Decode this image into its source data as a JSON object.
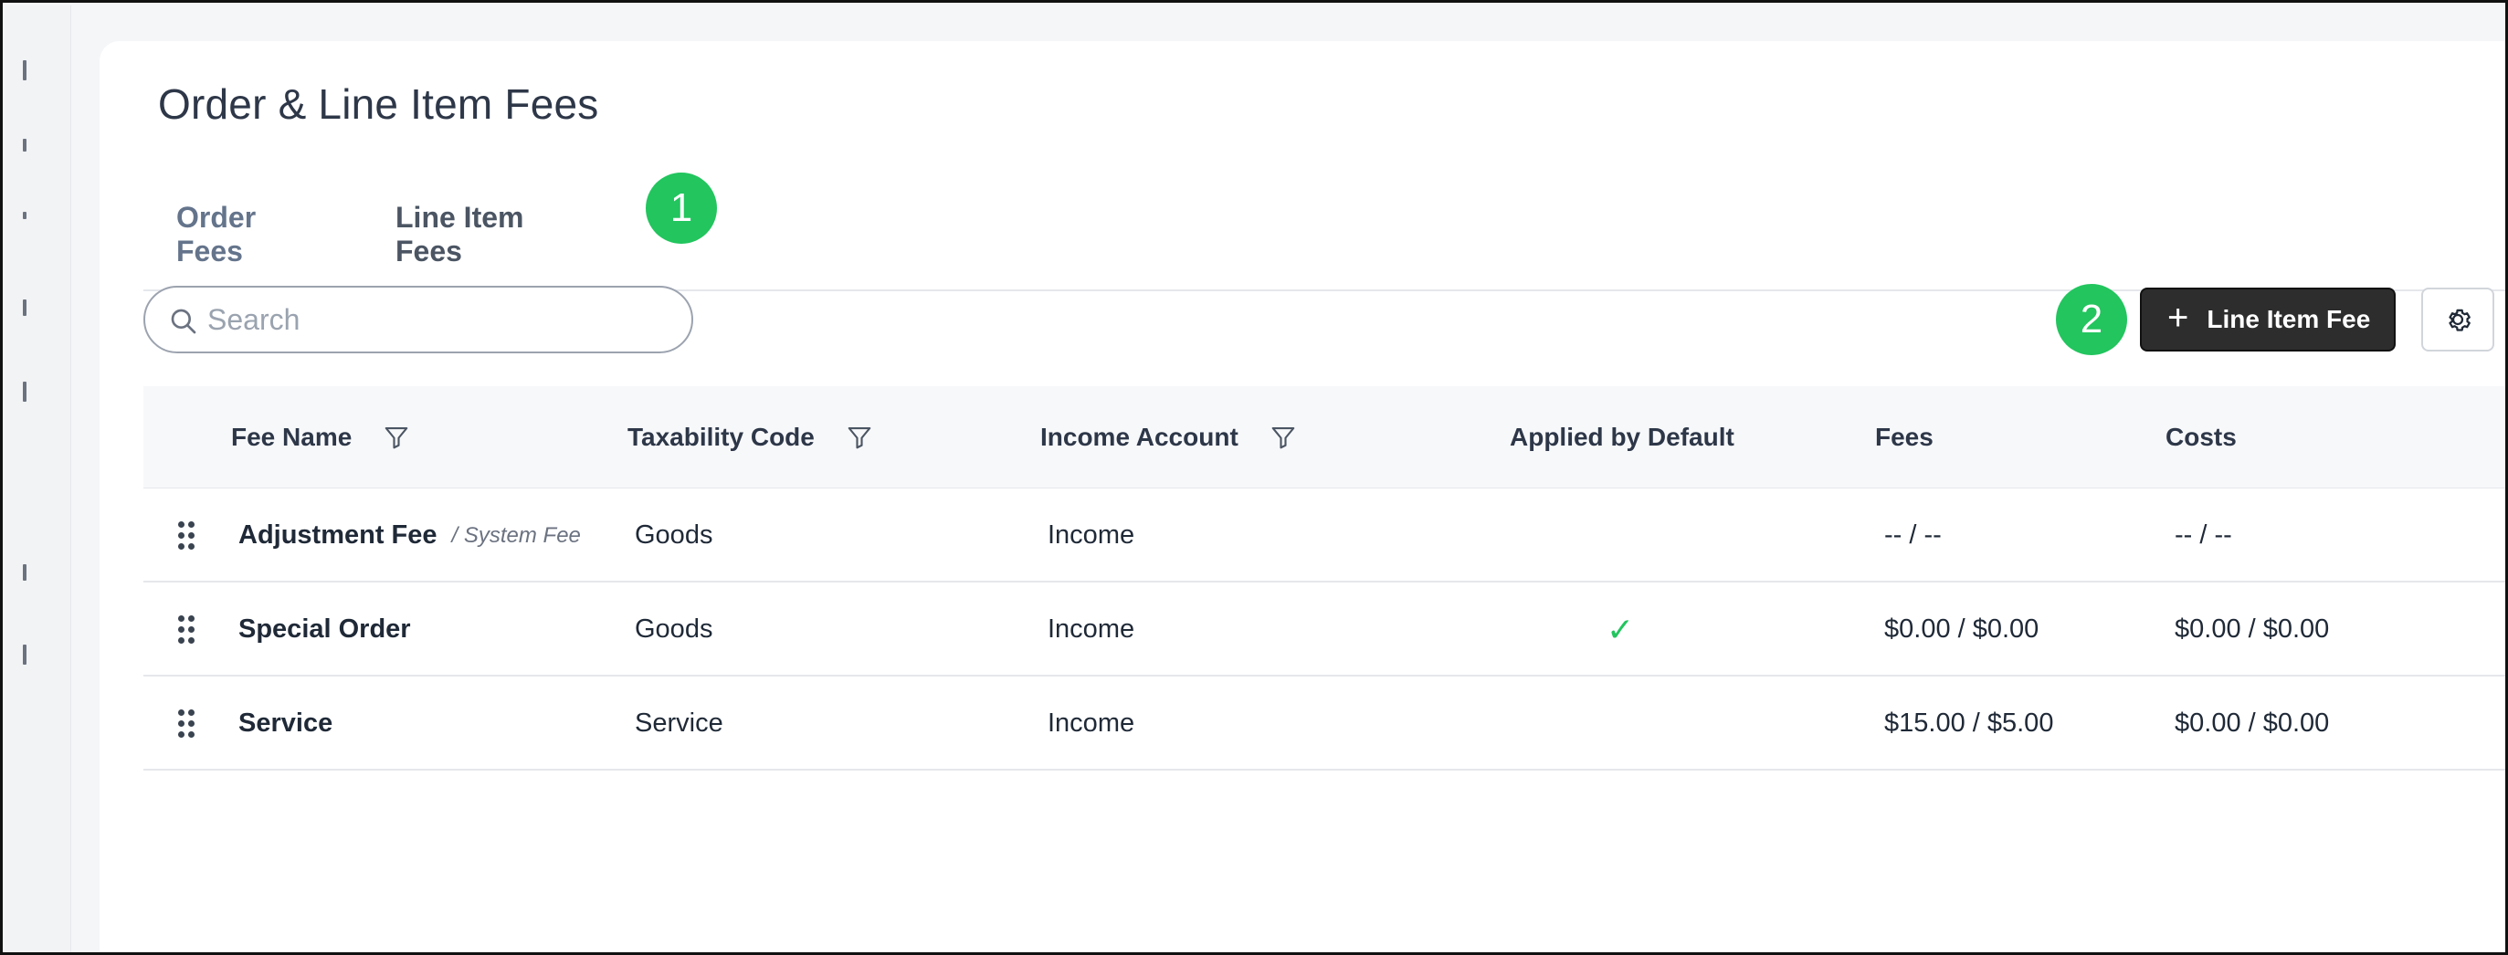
{
  "page": {
    "title": "Order & Line Item Fees"
  },
  "tabs": [
    {
      "label": "Order Fees",
      "active": false
    },
    {
      "label": "Line Item Fees",
      "active": true
    }
  ],
  "annotations": {
    "step1": "1",
    "step2": "2",
    "color": "#22c55e"
  },
  "search": {
    "placeholder": "Search",
    "value": ""
  },
  "toolbar": {
    "add_label": "Line Item Fee",
    "add_icon": "plus-icon",
    "settings_icon": "gear-icon"
  },
  "table": {
    "headers": {
      "fee_name": "Fee Name",
      "taxability_code": "Taxability Code",
      "income_account": "Income Account",
      "applied_by_default": "Applied by Default",
      "fees": "Fees",
      "costs": "Costs"
    },
    "rows": [
      {
        "fee_name": "Adjustment Fee",
        "tag": "/ System Fee",
        "taxability_code": "Goods",
        "income_account": "Income",
        "applied_by_default": "",
        "fees": "-- / --",
        "costs": "-- / --"
      },
      {
        "fee_name": "Special Order",
        "tag": "",
        "taxability_code": "Goods",
        "income_account": "Income",
        "applied_by_default": "✓",
        "fees": "$0.00 / $0.00",
        "costs": "$0.00 / $0.00"
      },
      {
        "fee_name": "Service",
        "tag": "",
        "taxability_code": "Service",
        "income_account": "Income",
        "applied_by_default": "",
        "fees": "$15.00 / $5.00",
        "costs": "$0.00 / $0.00"
      }
    ]
  },
  "colors": {
    "accent_green": "#22c55e",
    "primary_button": "#2d2d2d",
    "text_dark": "#2d3748"
  }
}
